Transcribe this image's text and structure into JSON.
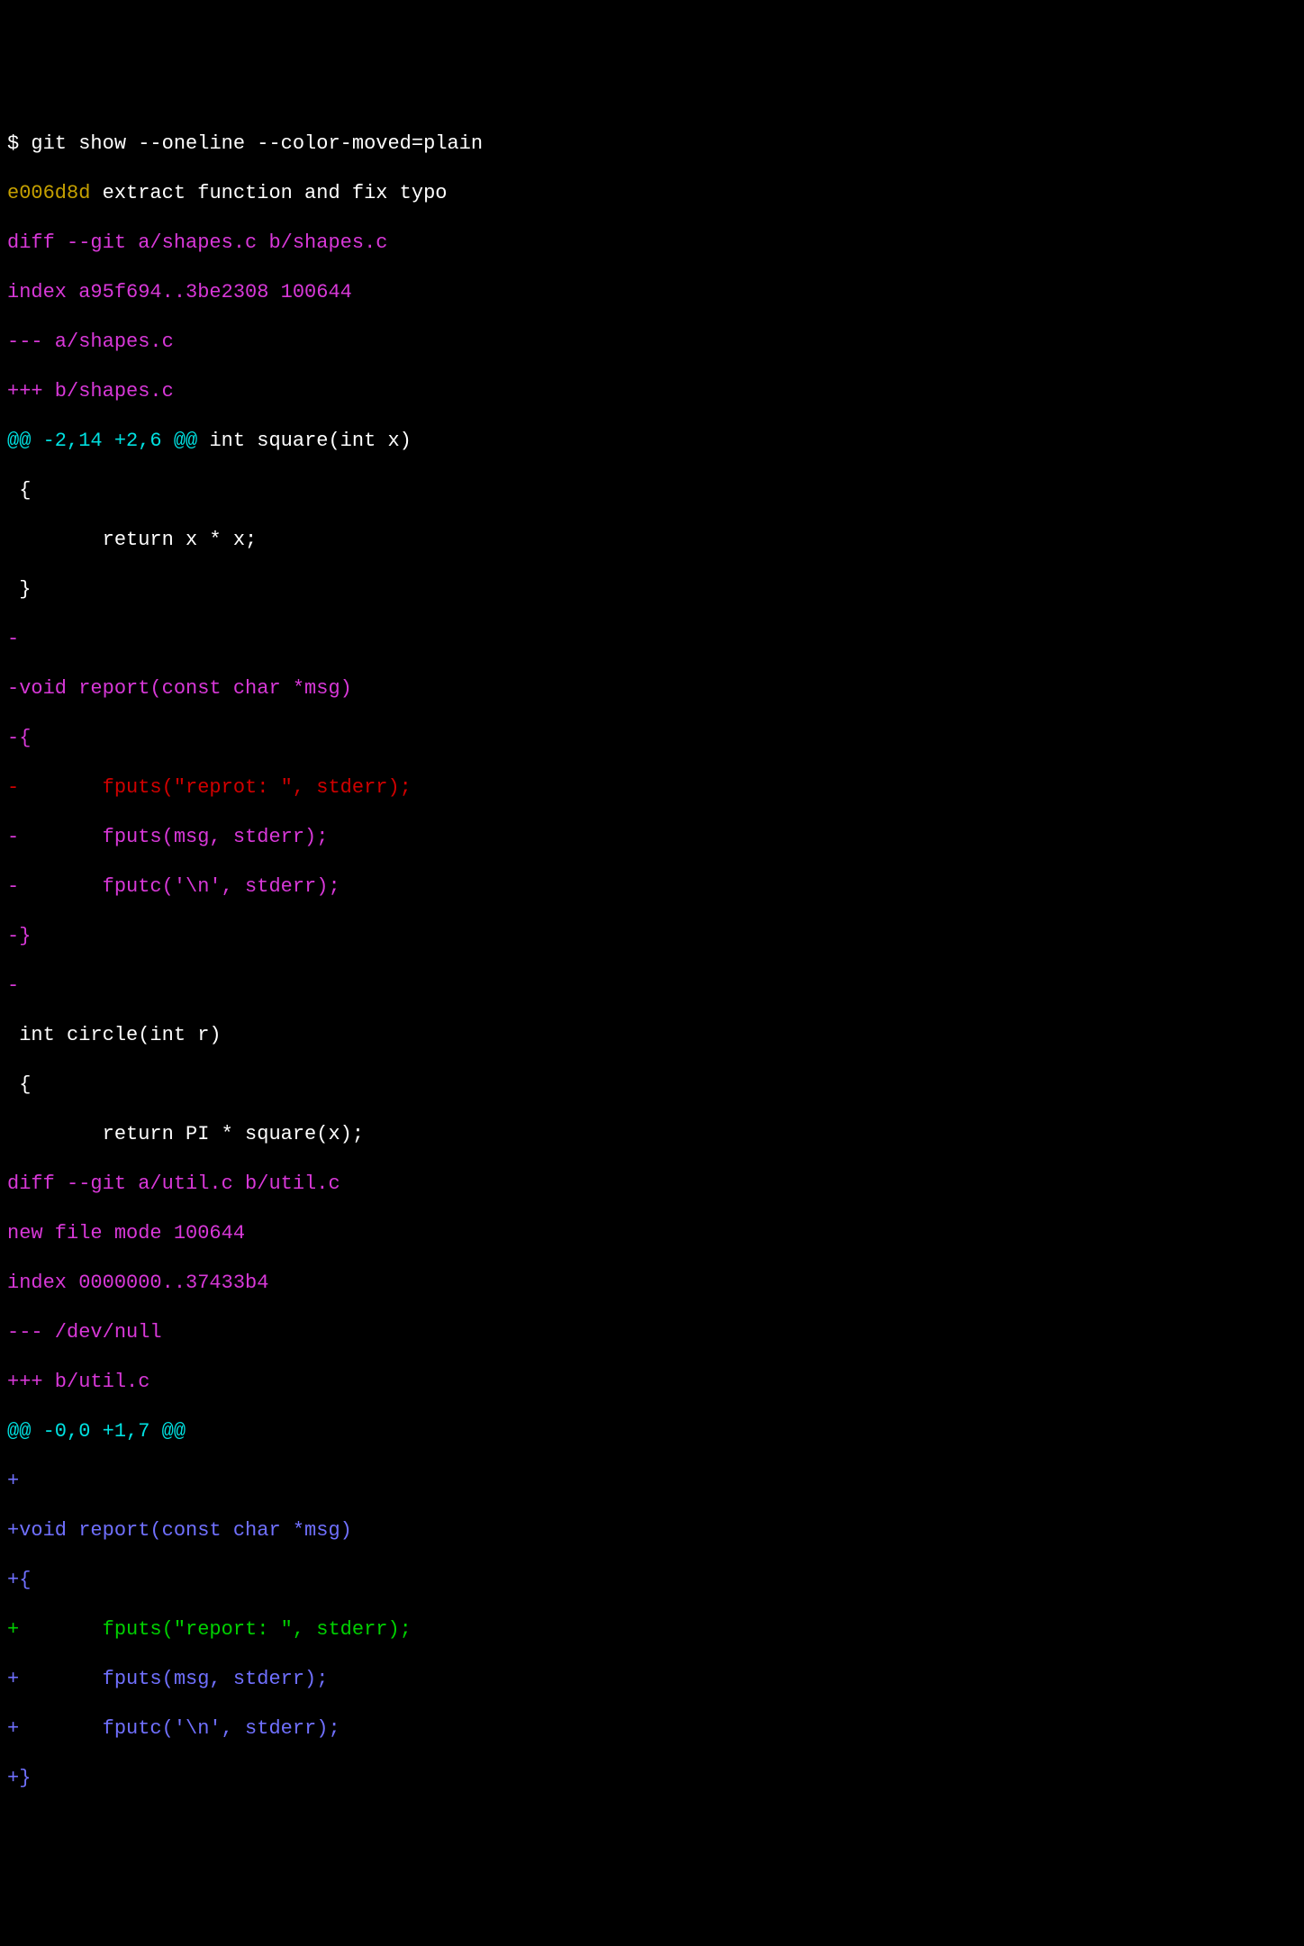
{
  "prompt": "$ ",
  "command": "git show --oneline --color-moved=plain",
  "commit_hash": "e006d8d",
  "commit_msg": " extract function and fix typo",
  "diff_header_1": "diff --git a/shapes.c b/shapes.c",
  "index_1": "index a95f694..3be2308 100644",
  "file_minus_1": "--- a/shapes.c",
  "file_plus_1": "+++ b/shapes.c",
  "hunk1_at": "@@ ",
  "hunk1_range": "-2,14 +2,6",
  "hunk1_at2": " @@",
  "hunk1_ctx": " int square(int x)",
  "ctx_brace_open": " {",
  "ctx_return_sq": "        return x * x;",
  "ctx_brace_close": " }",
  "del_blank1": "-",
  "del_void_report": "-void report(const char *msg)",
  "del_brace_open": "-{",
  "del_fputs_typo": "-       fputs(\"reprot: \", stderr);",
  "del_fputs_msg": "-       fputs(msg, stderr);",
  "del_fputc": "-       fputc('\\n', stderr);",
  "del_brace_close": "-}",
  "del_blank2": "-",
  "ctx_int_circle": " int circle(int r)",
  "ctx_brace_open2": " {",
  "ctx_return_pi": "        return PI * square(x);",
  "diff_header_2": "diff --git a/util.c b/util.c",
  "new_file_mode": "new file mode 100644",
  "index_2": "index 0000000..37433b4",
  "file_minus_2": "--- /dev/null",
  "file_plus_2": "+++ b/util.c",
  "hunk2_at": "@@ ",
  "hunk2_range": "-0,0 +1,7",
  "hunk2_at2": " @@",
  "add_blank": "+",
  "add_void_report": "+void report(const char *msg)",
  "add_brace_open": "+{",
  "add_fputs_fixed": "+       fputs(\"report: \", stderr);",
  "add_fputs_msg": "+       fputs(msg, stderr);",
  "add_fputc": "+       fputc('\\n', stderr);",
  "add_brace_close": "+}"
}
